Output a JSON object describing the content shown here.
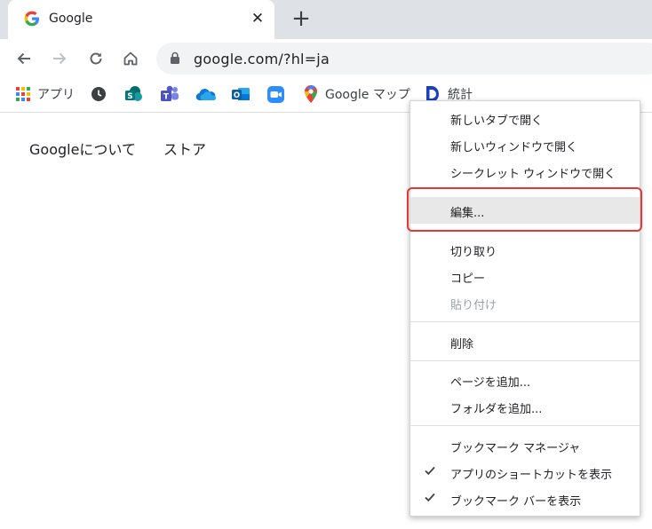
{
  "tab": {
    "title": "Google",
    "close_label": "✕",
    "new_tab_label": "+"
  },
  "toolbar": {
    "url": "google.com/?hl=ja"
  },
  "bookmarks": {
    "apps_label": "アプリ",
    "maps_label": "Google マップ",
    "stats_label": "統計"
  },
  "page": {
    "about_link": "Googleについて",
    "store_link": "ストア"
  },
  "context_menu": {
    "items": [
      {
        "label": "新しいタブで開く"
      },
      {
        "label": "新しいウィンドウで開く"
      },
      {
        "label": "シークレット ウィンドウで開く"
      },
      {
        "label": "編集..."
      },
      {
        "label": "切り取り"
      },
      {
        "label": "コピー"
      },
      {
        "label": "貼り付け",
        "disabled": true
      },
      {
        "label": "削除"
      },
      {
        "label": "ページを追加..."
      },
      {
        "label": "フォルダを追加..."
      },
      {
        "label": "ブックマーク マネージャ"
      },
      {
        "label": "アプリのショートカットを表示",
        "checked": true
      },
      {
        "label": "ブックマーク バーを表示",
        "checked": true
      }
    ]
  },
  "colors": {
    "highlight_border": "#e33838",
    "tab_strip": "#dee1e6"
  }
}
